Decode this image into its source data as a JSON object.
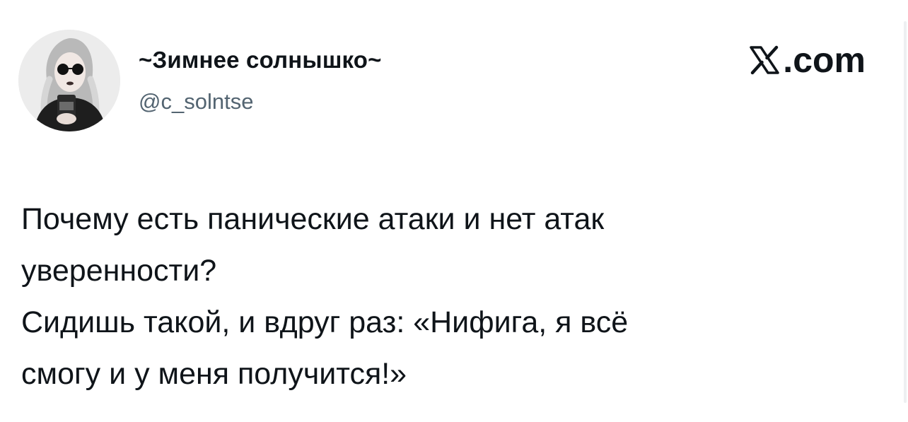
{
  "tweet": {
    "author": {
      "display_name": "~Зимнее солнышко~",
      "handle": "@c_solntse",
      "avatar_icon": "profile-photo"
    },
    "brand": {
      "icon": "x-logo-icon",
      "suffix": ".com"
    },
    "lines": [
      "Почему есть панические атаки и нет атак",
      "уверенности?",
      "Сидишь такой, и вдруг раз: «Нифига, я всё",
      "смогу и у меня получится!»"
    ]
  },
  "colors": {
    "text": "#0f1419",
    "secondary_text": "#536471",
    "background": "#ffffff"
  }
}
